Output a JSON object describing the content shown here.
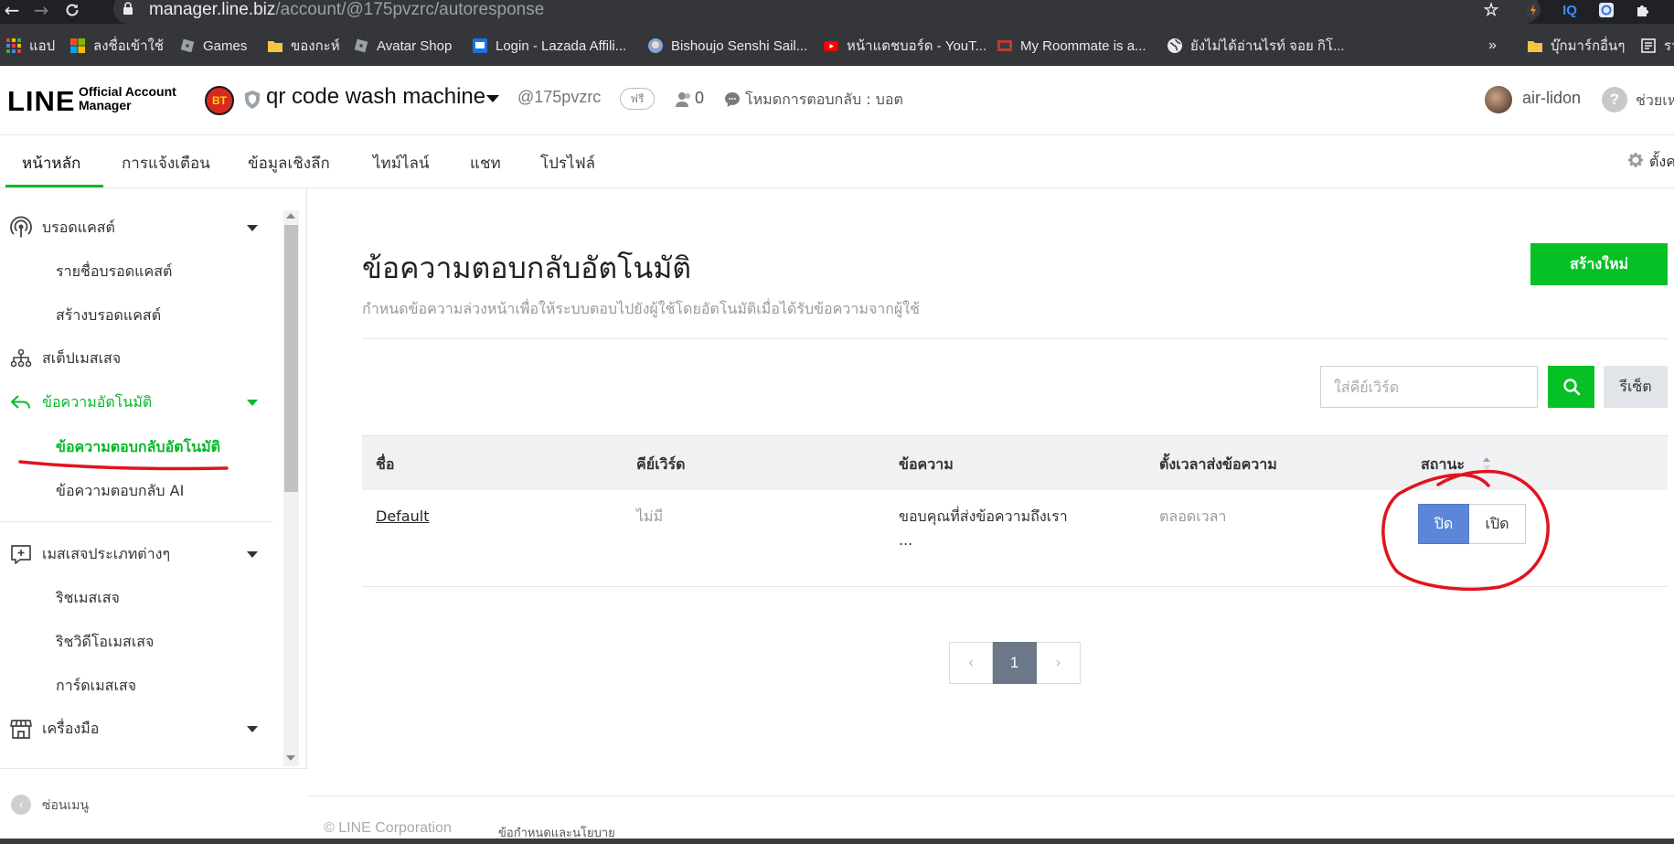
{
  "browser": {
    "url_host": "manager.line.biz",
    "url_path": "/account/@175pvzrc/autoresponse",
    "back_icon": "arrow-left-icon",
    "forward_icon": "arrow-right-icon",
    "reload_icon": "reload-icon",
    "ext_iq": "IQ",
    "bookmarks": [
      {
        "label": "แอป",
        "color": "#ea4335"
      },
      {
        "label": "ลงชื่อเข้าใช้",
        "color": "#00a4ef"
      },
      {
        "label": "Games",
        "color": "#6b6b6b"
      },
      {
        "label": "ของกะห์",
        "color": "#f4c542"
      },
      {
        "label": "Avatar Shop",
        "color": "#6b6b6b"
      },
      {
        "label": "Login - Lazada Affili...",
        "color": "#1a73e8"
      },
      {
        "label": "Bishoujo Senshi Sail...",
        "color": "#7fa7d9"
      },
      {
        "label": "หน้าแดชบอร์ด - YouT...",
        "color": "#ff0000"
      },
      {
        "label": "My Roommate is a...",
        "color": "#c0392b"
      },
      {
        "label": "ยังไม่ได้อ่านไรท์ จอย กิโ...",
        "color": "#e8eaed"
      },
      {
        "label": "»",
        "color": ""
      },
      {
        "label": "บุ๊กมาร์กอื่นๆ",
        "color": "#f4c542"
      },
      {
        "label": "รา",
        "color": "#e8eaed"
      }
    ]
  },
  "header": {
    "logo_main": "LINE",
    "logo_sub_1": "Official Account",
    "logo_sub_2": "Manager",
    "account_avatar": "BT",
    "account_name": "qr code wash machine",
    "account_id": "@175pvzrc",
    "plan_badge": "ฟรี",
    "friends_count": "0",
    "reply_mode": "โหมดการตอบกลับ : บอต",
    "user_name": "air-lidon",
    "help_glyph": "?",
    "help_label": "ช่วยเห"
  },
  "tabs": [
    {
      "label": "หน้าหลัก",
      "active": true
    },
    {
      "label": "การแจ้งเตือน"
    },
    {
      "label": "ข้อมูลเชิงลึก"
    },
    {
      "label": "ไทม์ไลน์"
    },
    {
      "label": "แชท"
    },
    {
      "label": "โปรไฟล์"
    }
  ],
  "settings_label": "ตั้งค",
  "sidebar": {
    "broadcast": "บรอดแคสต์",
    "broadcast_list": "รายชื่อบรอดแคสต์",
    "broadcast_create": "สร้างบรอดแคสต์",
    "step_message": "สเต็ปเมสเสจ",
    "auto_message": "ข้อความอัตโนมัติ",
    "auto_reply": "ข้อความตอบกลับอัตโนมัติ",
    "ai_reply": "ข้อความตอบกลับ AI",
    "message_types": "เมสเสจประเภทต่างๆ",
    "rich_message": "ริชเมสเสจ",
    "rich_video": "ริชวิดีโอเมสเสจ",
    "card_message": "การ์ดเมสเสจ",
    "tools": "เครื่องมือ",
    "collapse_glyph": "‹",
    "collapse": "ซ่อนเมนู"
  },
  "main": {
    "title": "ข้อความตอบกลับอัตโนมัติ",
    "subtitle": "กำหนดข้อความล่วงหน้าเพื่อให้ระบบตอบไปยังผู้ใช้โดยอัตโนมัติเมื่อได้รับข้อความจากผู้ใช้",
    "create_button": "สร้างใหม่",
    "search_placeholder": "ใส่คีย์เวิร์ด",
    "reset_button": "รีเซ็ต",
    "columns": {
      "name": "ชื่อ",
      "keyword": "คีย์เวิร์ด",
      "message": "ข้อความ",
      "schedule": "ตั้งเวลาส่งข้อความ",
      "status": "สถานะ"
    },
    "rows": [
      {
        "name": "Default",
        "keyword": "ไม่มี",
        "message_line1": "ขอบคุณที่ส่งข้อความถึงเรา",
        "message_line2": "...",
        "schedule": "ตลอดเวลา",
        "status_off": "ปิด",
        "status_on": "เปิด",
        "status_selected": "off"
      }
    ],
    "pagination": {
      "current_page": "1",
      "prev_glyph": "‹",
      "next_glyph": "›"
    }
  },
  "footer": {
    "copyright": "© LINE Corporation",
    "terms": "ข้อกำหนดและนโยบาย"
  },
  "colors": {
    "line_green": "#06c126",
    "active_tab_underline": "#06b826",
    "toggle_off_blue": "#5b86d9",
    "annotation_red": "#e0141e",
    "pager_current": "#6c7788"
  }
}
